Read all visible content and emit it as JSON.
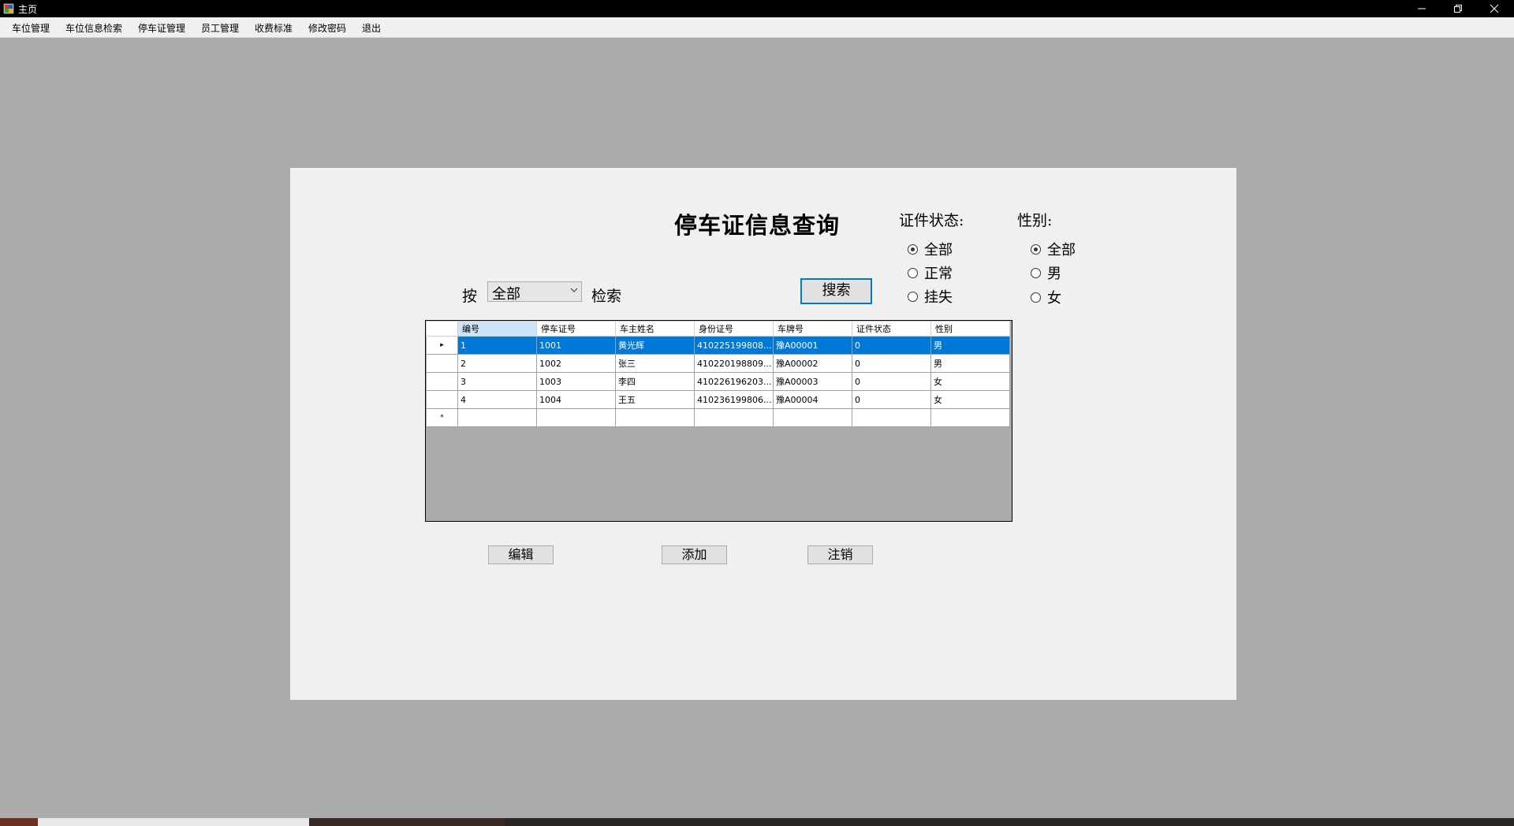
{
  "window": {
    "title": "主页"
  },
  "menu": [
    "车位管理",
    "车位信息检索",
    "停车证管理",
    "员工管理",
    "收费标准",
    "修改密码",
    "退出"
  ],
  "page": {
    "title": "停车证信息查询",
    "search_prefix": "按",
    "search_combo_value": "全部",
    "search_suffix": "检索",
    "search_button": "搜索"
  },
  "status_group": {
    "label": "证件状态:",
    "options": [
      "全部",
      "正常",
      "挂失"
    ],
    "selected": "全部"
  },
  "gender_group": {
    "label": "性别:",
    "options": [
      "全部",
      "男",
      "女"
    ],
    "selected": "全部"
  },
  "grid": {
    "columns": [
      "编号",
      "停车证号",
      "车主姓名",
      "身份证号",
      "车牌号",
      "证件状态",
      "性别"
    ],
    "rows": [
      [
        "1",
        "1001",
        "黄光辉",
        "410225199808...",
        "豫A00001",
        "0",
        "男"
      ],
      [
        "2",
        "1002",
        "张三",
        "410220198809...",
        "豫A00002",
        "0",
        "男"
      ],
      [
        "3",
        "1003",
        "李四",
        "410226196203...",
        "豫A00003",
        "0",
        "女"
      ],
      [
        "4",
        "1004",
        "王五",
        "410236199806...",
        "豫A00004",
        "0",
        "女"
      ]
    ],
    "selected_row": 0,
    "new_row_marker": "*",
    "current_row_marker": "▸"
  },
  "buttons": {
    "edit": "编辑",
    "add": "添加",
    "cancel": "注销"
  },
  "colors": {
    "selection": "#0078d7",
    "panel": "#f0f0f0",
    "background": "#ababab"
  }
}
